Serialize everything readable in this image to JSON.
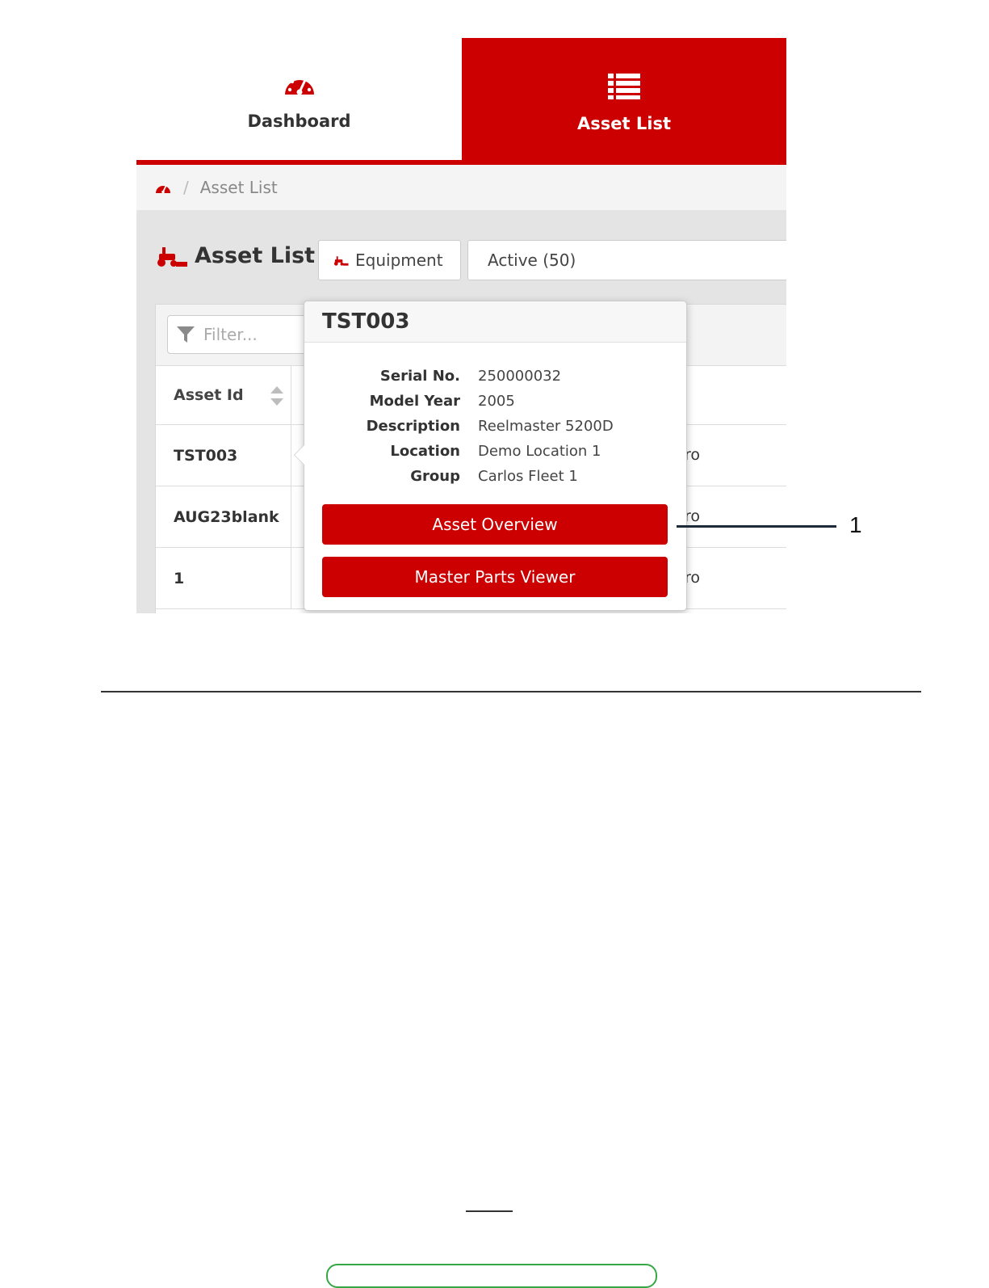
{
  "nav": {
    "dashboard_label": "Dashboard",
    "asset_list_label": "Asset List"
  },
  "breadcrumb": {
    "separator": "/",
    "current": "Asset List"
  },
  "page": {
    "title": "Asset List",
    "equipment_button": "Equipment",
    "status_select": "Active (50)"
  },
  "table": {
    "filter_placeholder": "Filter...",
    "column_asset_id": "Asset Id",
    "rows": [
      {
        "id": "TST003",
        "frag": "ro"
      },
      {
        "id": "AUG23blank",
        "frag": "ro"
      },
      {
        "id": "1",
        "frag": "ro"
      }
    ]
  },
  "popover": {
    "title": "TST003",
    "fields": [
      {
        "label": "Serial No.",
        "value": "250000032"
      },
      {
        "label": "Model Year",
        "value": "2005"
      },
      {
        "label": "Description",
        "value": "Reelmaster 5200D"
      },
      {
        "label": "Location",
        "value": "Demo Location 1"
      },
      {
        "label": "Group",
        "value": "Carlos Fleet 1"
      }
    ],
    "asset_overview_button": "Asset Overview",
    "master_parts_button": "Master Parts Viewer"
  },
  "callout": {
    "number": "1"
  },
  "colors": {
    "brand_red": "#cc0000",
    "callout_line": "#1c2a3a"
  }
}
